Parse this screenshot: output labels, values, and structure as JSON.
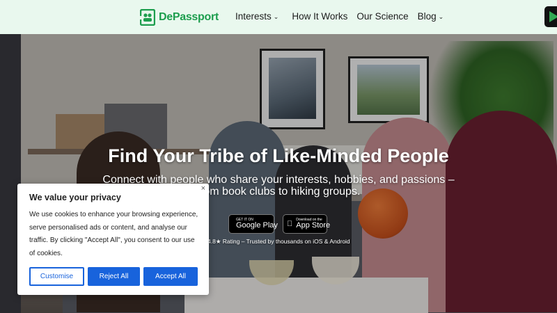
{
  "brand": {
    "name": "DePassport",
    "color": "#1d9e4e"
  },
  "nav": {
    "items": [
      {
        "label": "Interests",
        "has_dropdown": true
      },
      {
        "label": "How It Works",
        "has_dropdown": false
      },
      {
        "label": "Our Science",
        "has_dropdown": false
      },
      {
        "label": "Blog",
        "has_dropdown": true
      }
    ],
    "dropdown_icon": "chevron-down-icon"
  },
  "header_store_icon": "google-play-icon",
  "hero": {
    "title": "Find Your Tribe of Like-Minded People",
    "subtitle_line1": "Connect with people who share your interests, hobbies, and passions –",
    "subtitle_line2": "from book clubs to hiking groups.",
    "google_play": {
      "small": "GET IT ON",
      "big": "Google Play"
    },
    "app_store": {
      "small": "Download on the",
      "big": "App Store"
    },
    "rating": "4.8★ Rating – Trusted by thousands on iOS & Android"
  },
  "cookie": {
    "title": "We value your privacy",
    "body": "We use cookies to enhance your browsing experience, serve personalised ads or content, and analyse our traffic. By clicking \"Accept All\", you consent to our use of cookies.",
    "close": "×",
    "buttons": {
      "customise": "Customise",
      "reject": "Reject All",
      "accept": "Accept All"
    },
    "accent": "#1863dc"
  }
}
